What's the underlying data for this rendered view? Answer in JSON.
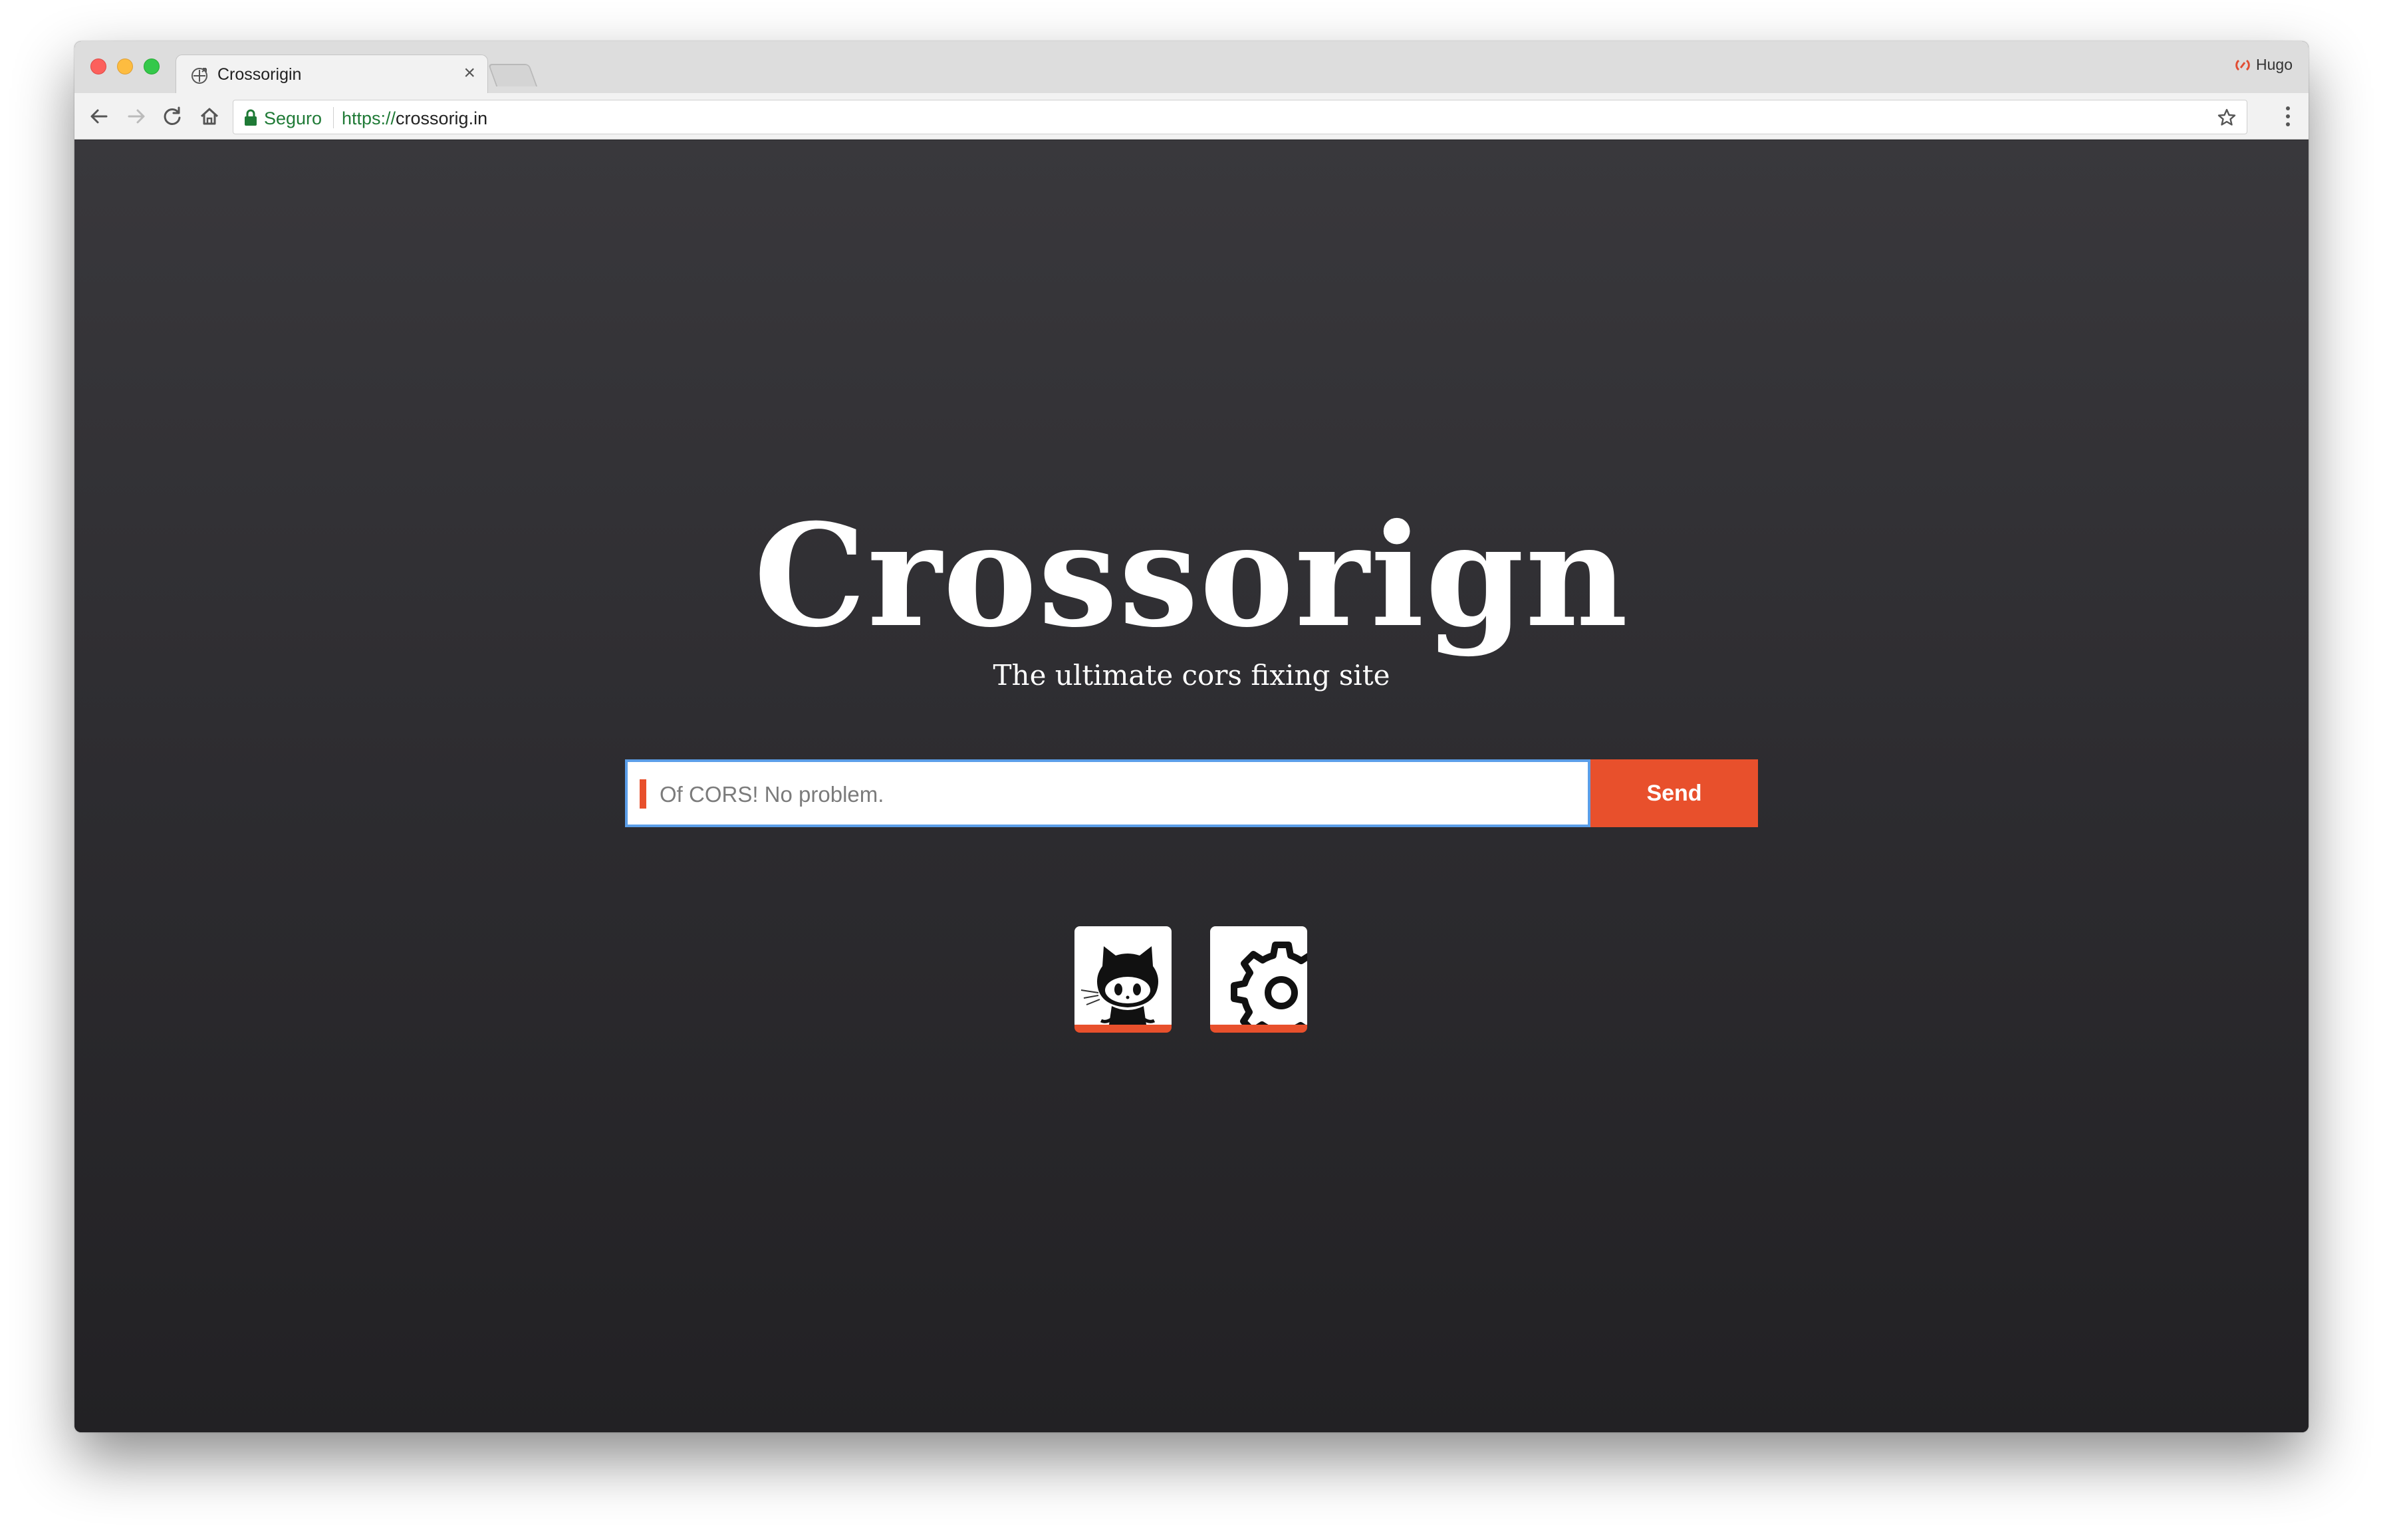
{
  "browser": {
    "tab": {
      "title": "Crossorigin",
      "close": "×",
      "favicon": "crossorigin-favicon-icon"
    },
    "profile": {
      "name": "Hugo",
      "icon": "profile-sync-icon"
    },
    "omnibox": {
      "security_label": "Seguro",
      "url_scheme": "https://",
      "url_host": "crossorig.in"
    }
  },
  "page": {
    "title": "Crossorign",
    "subtitle": "The ultimate cors fixing site",
    "search": {
      "placeholder": "Of CORS! No problem.",
      "button": "Send"
    },
    "links": [
      {
        "icon": "github-octocat-icon"
      },
      {
        "icon": "settings-gear-icon"
      }
    ],
    "colors": {
      "accent": "#e8502c",
      "background": "#2e2d31",
      "focus_ring": "#5b9ee8"
    }
  }
}
